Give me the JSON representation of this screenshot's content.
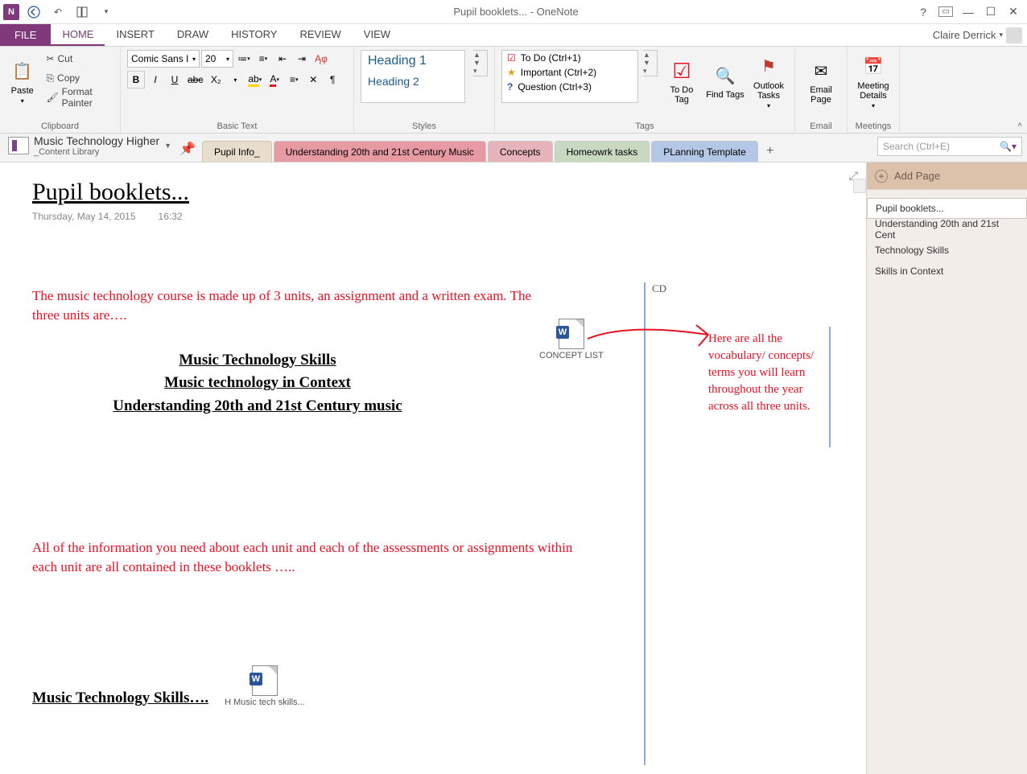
{
  "titlebar": {
    "title": "Pupil booklets... - OneNote",
    "user": "Claire Derrick"
  },
  "ribbon_tabs": [
    "FILE",
    "HOME",
    "INSERT",
    "DRAW",
    "HISTORY",
    "REVIEW",
    "VIEW"
  ],
  "clipboard": {
    "paste": "Paste",
    "cut": "Cut",
    "copy": "Copy",
    "format_painter": "Format Painter",
    "label": "Clipboard"
  },
  "basictext": {
    "font": "Comic Sans I",
    "size": "20",
    "label": "Basic Text"
  },
  "styles": {
    "h1": "Heading 1",
    "h2": "Heading 2",
    "label": "Styles"
  },
  "tags": {
    "items": [
      {
        "icon": "☐",
        "text": "To Do (Ctrl+1)",
        "color": "#e81123"
      },
      {
        "icon": "★",
        "text": "Important (Ctrl+2)",
        "color": "#e8a200"
      },
      {
        "icon": "?",
        "text": "Question (Ctrl+3)",
        "color": "#2b579a"
      }
    ],
    "todo": "To Do Tag",
    "find": "Find Tags",
    "outlook": "Outlook Tasks",
    "label": "Tags"
  },
  "email": {
    "btn": "Email Page",
    "label": "Email"
  },
  "meetings": {
    "btn": "Meeting Details",
    "label": "Meetings"
  },
  "notebook": {
    "name": "Music Technology Higher",
    "section": "_Content Library"
  },
  "sections": [
    {
      "label": "Pupil Info_",
      "bg": "#e8dccc",
      "active": true
    },
    {
      "label": "Understanding 20th and 21st Century Music",
      "bg": "#e89aa4"
    },
    {
      "label": "Concepts",
      "bg": "#e8b4bc"
    },
    {
      "label": "Homeowrk tasks",
      "bg": "#c9d8c0"
    },
    {
      "label": "PLanning Template",
      "bg": "#b4c7e7"
    }
  ],
  "search_placeholder": "Search (Ctrl+E)",
  "page": {
    "title": "Pupil booklets...",
    "date": "Thursday, May 14, 2015",
    "time": "16:32",
    "intro": "The music technology course is made up of 3 units, an assignment and a written exam.  The three units are….",
    "unit1": "Music Technology Skills",
    "unit2": "Music technology in Context",
    "unit3": "Understanding 20th and 21st Century music",
    "attach1_label": "CONCEPT LIST",
    "cd_label": "CD",
    "side_note": "Here are all the vocabulary/ concepts/ terms you will learn throughout the year across all three units.",
    "info_para": "All of the information you need about each unit and each of the assessments or assignments within each unit are all contained in these booklets …..",
    "sec2_title": "Music Technology Skills….",
    "attach2_label": "H Music tech skills..."
  },
  "addpage": "Add Page",
  "pagelist": [
    {
      "label": "Pupil booklets...",
      "sel": true
    },
    {
      "label": "Understanding 20th and 21st Cent"
    },
    {
      "label": "Technology Skills"
    },
    {
      "label": "Skills in Context"
    }
  ]
}
